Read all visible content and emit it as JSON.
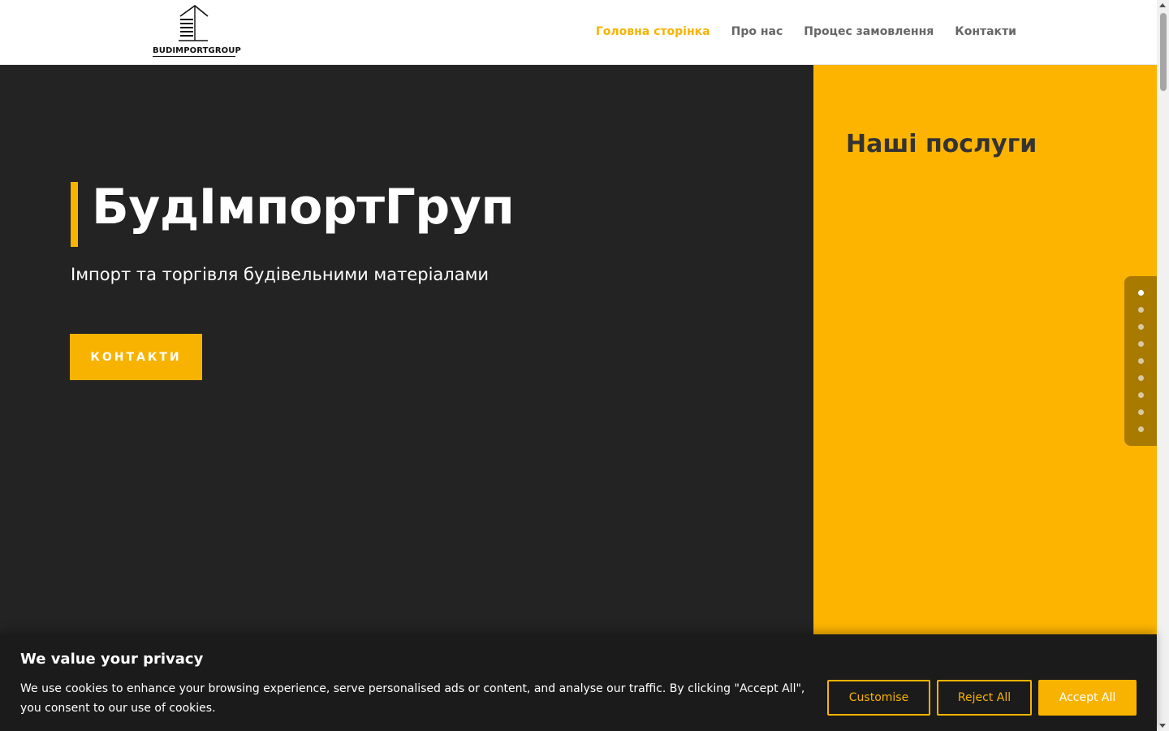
{
  "header": {
    "logo_text": "BUDIMPORTGROUP",
    "nav": [
      {
        "label": "Головна сторінка",
        "active": true
      },
      {
        "label": "Про нас",
        "active": false
      },
      {
        "label": "Процес замовлення",
        "active": false
      },
      {
        "label": "Контакти",
        "active": false
      }
    ]
  },
  "hero": {
    "title": "БудІмпортГруп",
    "subtitle": "Імпорт та торгівля будівельними матеріалами",
    "button_label": "КОНТАКТИ"
  },
  "services": {
    "title": "Наші послуги"
  },
  "side_nav": {
    "dot_count": 9,
    "active_index": 0
  },
  "cookie": {
    "title": "We value your privacy",
    "text": "We use cookies to enhance your browsing experience, serve personalised ads or content, and analyse our traffic. By clicking \"Accept All\", you consent to our use of cookies.",
    "customise_label": "Customise",
    "reject_label": "Reject All",
    "accept_label": "Accept All"
  },
  "colors": {
    "accent": "#f8b300",
    "hero_bg": "#232323",
    "services_bg": "#fdb400",
    "cookie_bg": "#1b1b1b"
  }
}
